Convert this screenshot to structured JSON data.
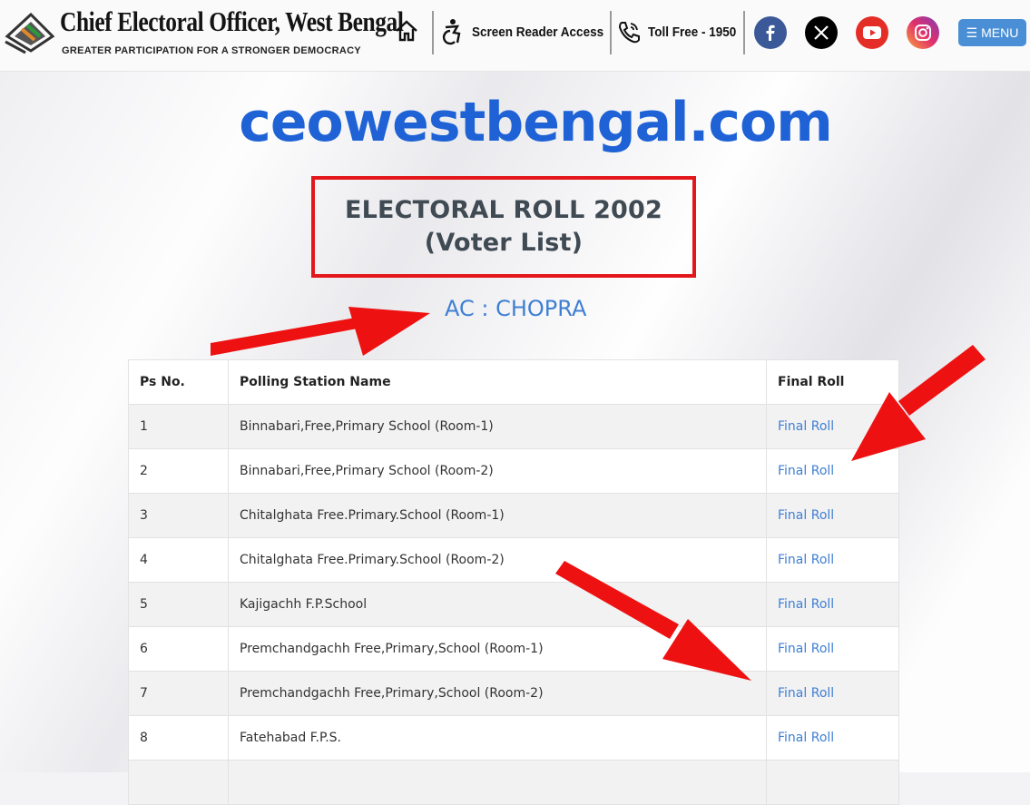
{
  "header": {
    "title": "Chief Electoral Officer, West Bengal",
    "tagline": "GREATER PARTICIPATION FOR A STRONGER DEMOCRACY",
    "screen_reader": "Screen Reader Access",
    "toll_free": "Toll Free - 1950",
    "menu_label": "☰ MENU",
    "social": [
      "facebook",
      "x",
      "youtube",
      "instagram"
    ]
  },
  "main": {
    "site_name": "ceowestbengal.com",
    "roll_title_line1": "ELECTORAL ROLL 2002",
    "roll_title_line2": "(Voter List)",
    "ac_label": "AC : CHOPRA"
  },
  "table": {
    "headers": [
      "Ps No.",
      "Polling Station Name",
      "Final Roll"
    ],
    "rows": [
      {
        "no": "1",
        "name": "Binnabari,Free,Primary School (Room-1)",
        "link": "Final Roll"
      },
      {
        "no": "2",
        "name": "Binnabari,Free,Primary School (Room-2)",
        "link": "Final Roll"
      },
      {
        "no": "3",
        "name": "Chitalghata Free.Primary.School (Room-1)",
        "link": "Final Roll"
      },
      {
        "no": "4",
        "name": "Chitalghata Free.Primary.School (Room-2)",
        "link": "Final Roll"
      },
      {
        "no": "5",
        "name": "Kajigachh F.P.School",
        "link": "Final Roll"
      },
      {
        "no": "6",
        "name": "Premchandgachh Free,Primary,School (Room-1)",
        "link": "Final Roll"
      },
      {
        "no": "7",
        "name": "Premchandgachh Free,Primary,School (Room-2)",
        "link": "Final Roll"
      },
      {
        "no": "8",
        "name": "Fatehabad F.P.S.",
        "link": "Final Roll"
      }
    ]
  },
  "colors": {
    "accent_blue": "#1e62d6",
    "link_blue": "#3f7fd3",
    "highlight_red": "#e3171b",
    "menu_blue": "#4a8fd6"
  }
}
